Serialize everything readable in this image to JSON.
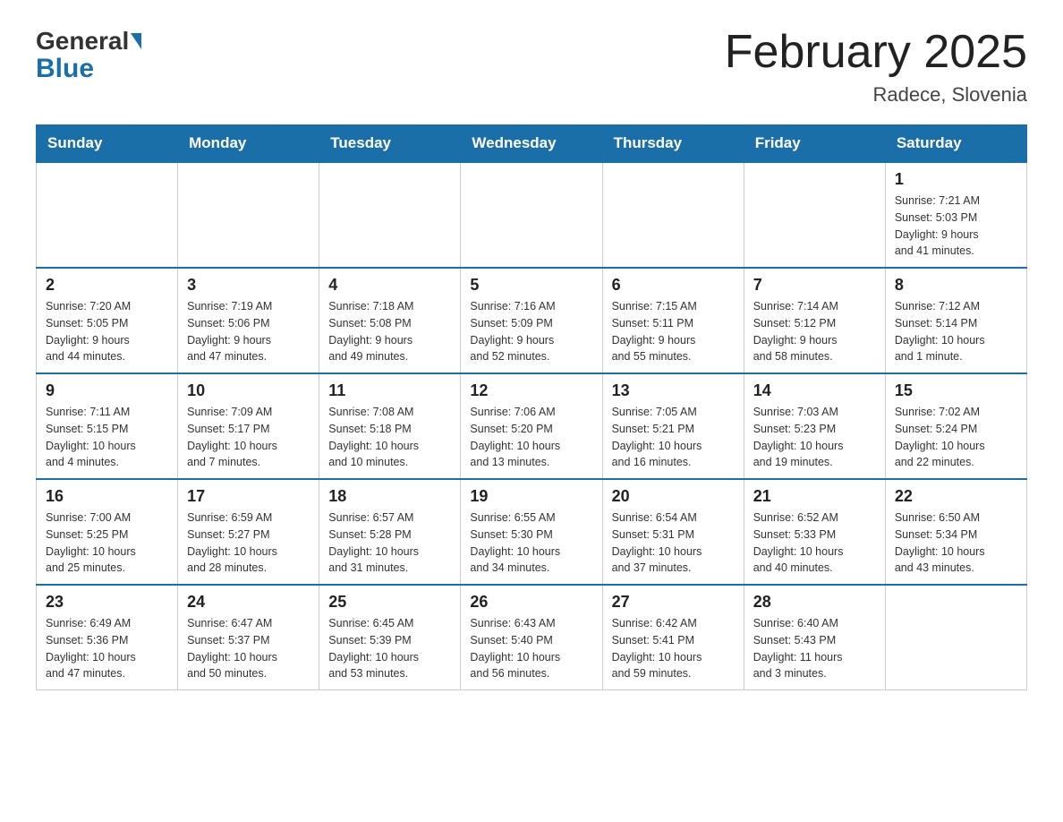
{
  "header": {
    "logo_general": "General",
    "logo_blue": "Blue",
    "title": "February 2025",
    "location": "Radece, Slovenia"
  },
  "days_of_week": [
    "Sunday",
    "Monday",
    "Tuesday",
    "Wednesday",
    "Thursday",
    "Friday",
    "Saturday"
  ],
  "weeks": [
    {
      "days": [
        {
          "number": "",
          "info": ""
        },
        {
          "number": "",
          "info": ""
        },
        {
          "number": "",
          "info": ""
        },
        {
          "number": "",
          "info": ""
        },
        {
          "number": "",
          "info": ""
        },
        {
          "number": "",
          "info": ""
        },
        {
          "number": "1",
          "info": "Sunrise: 7:21 AM\nSunset: 5:03 PM\nDaylight: 9 hours\nand 41 minutes."
        }
      ]
    },
    {
      "days": [
        {
          "number": "2",
          "info": "Sunrise: 7:20 AM\nSunset: 5:05 PM\nDaylight: 9 hours\nand 44 minutes."
        },
        {
          "number": "3",
          "info": "Sunrise: 7:19 AM\nSunset: 5:06 PM\nDaylight: 9 hours\nand 47 minutes."
        },
        {
          "number": "4",
          "info": "Sunrise: 7:18 AM\nSunset: 5:08 PM\nDaylight: 9 hours\nand 49 minutes."
        },
        {
          "number": "5",
          "info": "Sunrise: 7:16 AM\nSunset: 5:09 PM\nDaylight: 9 hours\nand 52 minutes."
        },
        {
          "number": "6",
          "info": "Sunrise: 7:15 AM\nSunset: 5:11 PM\nDaylight: 9 hours\nand 55 minutes."
        },
        {
          "number": "7",
          "info": "Sunrise: 7:14 AM\nSunset: 5:12 PM\nDaylight: 9 hours\nand 58 minutes."
        },
        {
          "number": "8",
          "info": "Sunrise: 7:12 AM\nSunset: 5:14 PM\nDaylight: 10 hours\nand 1 minute."
        }
      ]
    },
    {
      "days": [
        {
          "number": "9",
          "info": "Sunrise: 7:11 AM\nSunset: 5:15 PM\nDaylight: 10 hours\nand 4 minutes."
        },
        {
          "number": "10",
          "info": "Sunrise: 7:09 AM\nSunset: 5:17 PM\nDaylight: 10 hours\nand 7 minutes."
        },
        {
          "number": "11",
          "info": "Sunrise: 7:08 AM\nSunset: 5:18 PM\nDaylight: 10 hours\nand 10 minutes."
        },
        {
          "number": "12",
          "info": "Sunrise: 7:06 AM\nSunset: 5:20 PM\nDaylight: 10 hours\nand 13 minutes."
        },
        {
          "number": "13",
          "info": "Sunrise: 7:05 AM\nSunset: 5:21 PM\nDaylight: 10 hours\nand 16 minutes."
        },
        {
          "number": "14",
          "info": "Sunrise: 7:03 AM\nSunset: 5:23 PM\nDaylight: 10 hours\nand 19 minutes."
        },
        {
          "number": "15",
          "info": "Sunrise: 7:02 AM\nSunset: 5:24 PM\nDaylight: 10 hours\nand 22 minutes."
        }
      ]
    },
    {
      "days": [
        {
          "number": "16",
          "info": "Sunrise: 7:00 AM\nSunset: 5:25 PM\nDaylight: 10 hours\nand 25 minutes."
        },
        {
          "number": "17",
          "info": "Sunrise: 6:59 AM\nSunset: 5:27 PM\nDaylight: 10 hours\nand 28 minutes."
        },
        {
          "number": "18",
          "info": "Sunrise: 6:57 AM\nSunset: 5:28 PM\nDaylight: 10 hours\nand 31 minutes."
        },
        {
          "number": "19",
          "info": "Sunrise: 6:55 AM\nSunset: 5:30 PM\nDaylight: 10 hours\nand 34 minutes."
        },
        {
          "number": "20",
          "info": "Sunrise: 6:54 AM\nSunset: 5:31 PM\nDaylight: 10 hours\nand 37 minutes."
        },
        {
          "number": "21",
          "info": "Sunrise: 6:52 AM\nSunset: 5:33 PM\nDaylight: 10 hours\nand 40 minutes."
        },
        {
          "number": "22",
          "info": "Sunrise: 6:50 AM\nSunset: 5:34 PM\nDaylight: 10 hours\nand 43 minutes."
        }
      ]
    },
    {
      "days": [
        {
          "number": "23",
          "info": "Sunrise: 6:49 AM\nSunset: 5:36 PM\nDaylight: 10 hours\nand 47 minutes."
        },
        {
          "number": "24",
          "info": "Sunrise: 6:47 AM\nSunset: 5:37 PM\nDaylight: 10 hours\nand 50 minutes."
        },
        {
          "number": "25",
          "info": "Sunrise: 6:45 AM\nSunset: 5:39 PM\nDaylight: 10 hours\nand 53 minutes."
        },
        {
          "number": "26",
          "info": "Sunrise: 6:43 AM\nSunset: 5:40 PM\nDaylight: 10 hours\nand 56 minutes."
        },
        {
          "number": "27",
          "info": "Sunrise: 6:42 AM\nSunset: 5:41 PM\nDaylight: 10 hours\nand 59 minutes."
        },
        {
          "number": "28",
          "info": "Sunrise: 6:40 AM\nSunset: 5:43 PM\nDaylight: 11 hours\nand 3 minutes."
        },
        {
          "number": "",
          "info": ""
        }
      ]
    }
  ]
}
